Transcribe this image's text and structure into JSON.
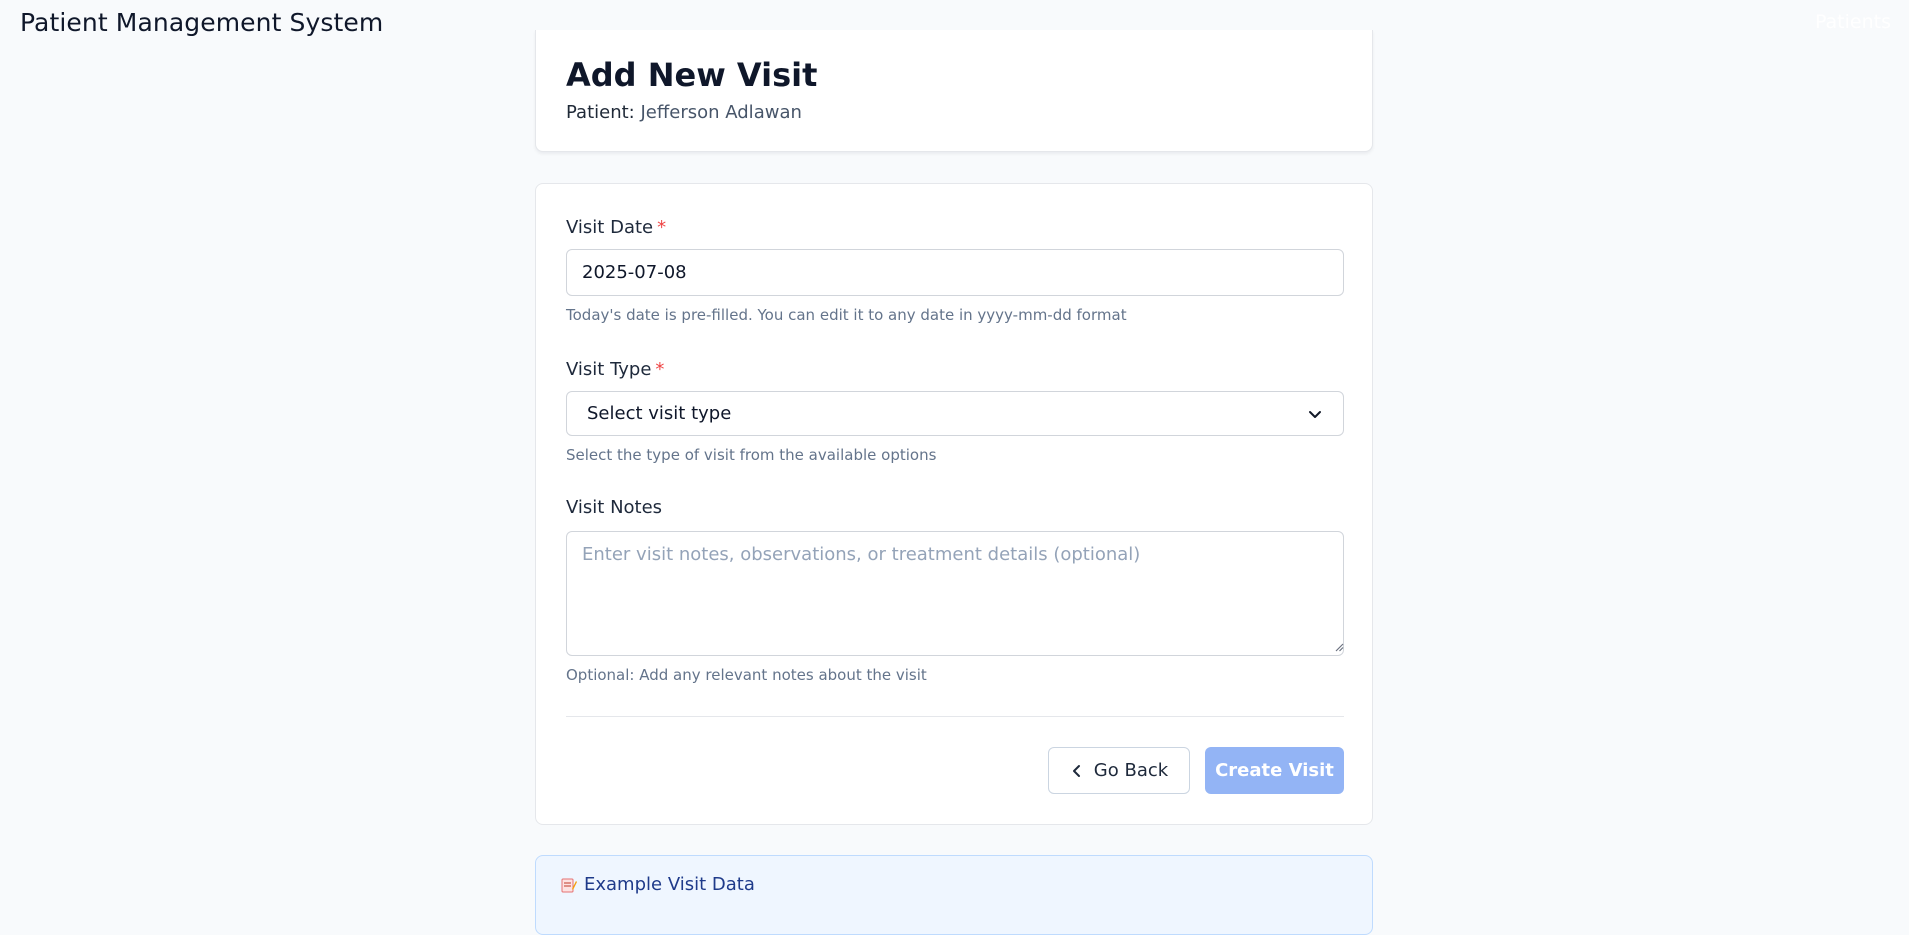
{
  "app": {
    "title": "Patient Management System",
    "nav_patients": "Patients"
  },
  "header": {
    "title": "Add New Visit",
    "patient_label": "Patient:",
    "patient_name": "Jefferson Adlawan"
  },
  "form": {
    "visit_date": {
      "label": "Visit Date",
      "required_marker": "*",
      "value": "2025-07-08",
      "help": "Today's date is pre-filled. You can edit it to any date in yyyy-mm-dd format"
    },
    "visit_type": {
      "label": "Visit Type",
      "required_marker": "*",
      "selected": "Select visit type",
      "help": "Select the type of visit from the available options"
    },
    "visit_notes": {
      "label": "Visit Notes",
      "placeholder": "Enter visit notes, observations, or treatment details (optional)",
      "help": "Optional: Add any relevant notes about the visit"
    },
    "buttons": {
      "back": "Go Back",
      "create": "Create Visit"
    }
  },
  "example": {
    "icon": "memo-icon",
    "title": "Example Visit Data"
  },
  "colors": {
    "required": "#ef4444",
    "create_button": "#93b4f5",
    "example_background": "#eff6ff",
    "example_title": "#1e3a8a"
  }
}
